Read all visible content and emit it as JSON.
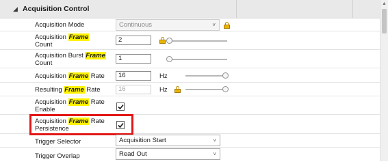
{
  "category": {
    "title": "Acquisition Control",
    "expander_glyph": "◢"
  },
  "rows": {
    "acquisition_mode": {
      "label_pre": "Acquisition Mode",
      "value": "Continuous"
    },
    "frame_count": {
      "label_pre": "Acquisition ",
      "label_hl": "Frame",
      "label_post": "Count",
      "value": "2"
    },
    "burst_frame_count": {
      "label_pre": "Acquisition Burst ",
      "label_hl": "Frame",
      "label_post": "Count",
      "value": "1"
    },
    "frame_rate": {
      "label_pre": "Acquisition ",
      "label_hl": "Frame",
      "label_post": " Rate",
      "value": "16",
      "unit": "Hz",
      "slider_level": 1.0
    },
    "resulting_frame_rate": {
      "label_pre": "Resulting ",
      "label_hl": "Frame",
      "label_post": " Rate",
      "value": "16",
      "unit": "Hz",
      "slider_level": 1.0
    },
    "frame_rate_enable": {
      "label_pre": "Acquisition ",
      "label_hl": "Frame",
      "label_post": " Rate",
      "label_line2": "Enable",
      "checked": true
    },
    "frame_rate_persistence": {
      "label_pre": "Acquisition ",
      "label_hl": "Frame",
      "label_post": " Rate",
      "label_line2": "Persistence",
      "checked": true
    },
    "trigger_selector": {
      "label_pre": "Trigger Selector",
      "value": "Acquisition Start"
    },
    "trigger_overlap": {
      "label_pre": "Trigger Overlap",
      "value": "Read Out"
    }
  },
  "icons": {
    "combo_arrow": "˅",
    "lock": "lock-icon",
    "scroll_up": "▲"
  },
  "colors": {
    "highlight": "#fff200",
    "callout": "#e31515",
    "lock": "#e8b400"
  }
}
